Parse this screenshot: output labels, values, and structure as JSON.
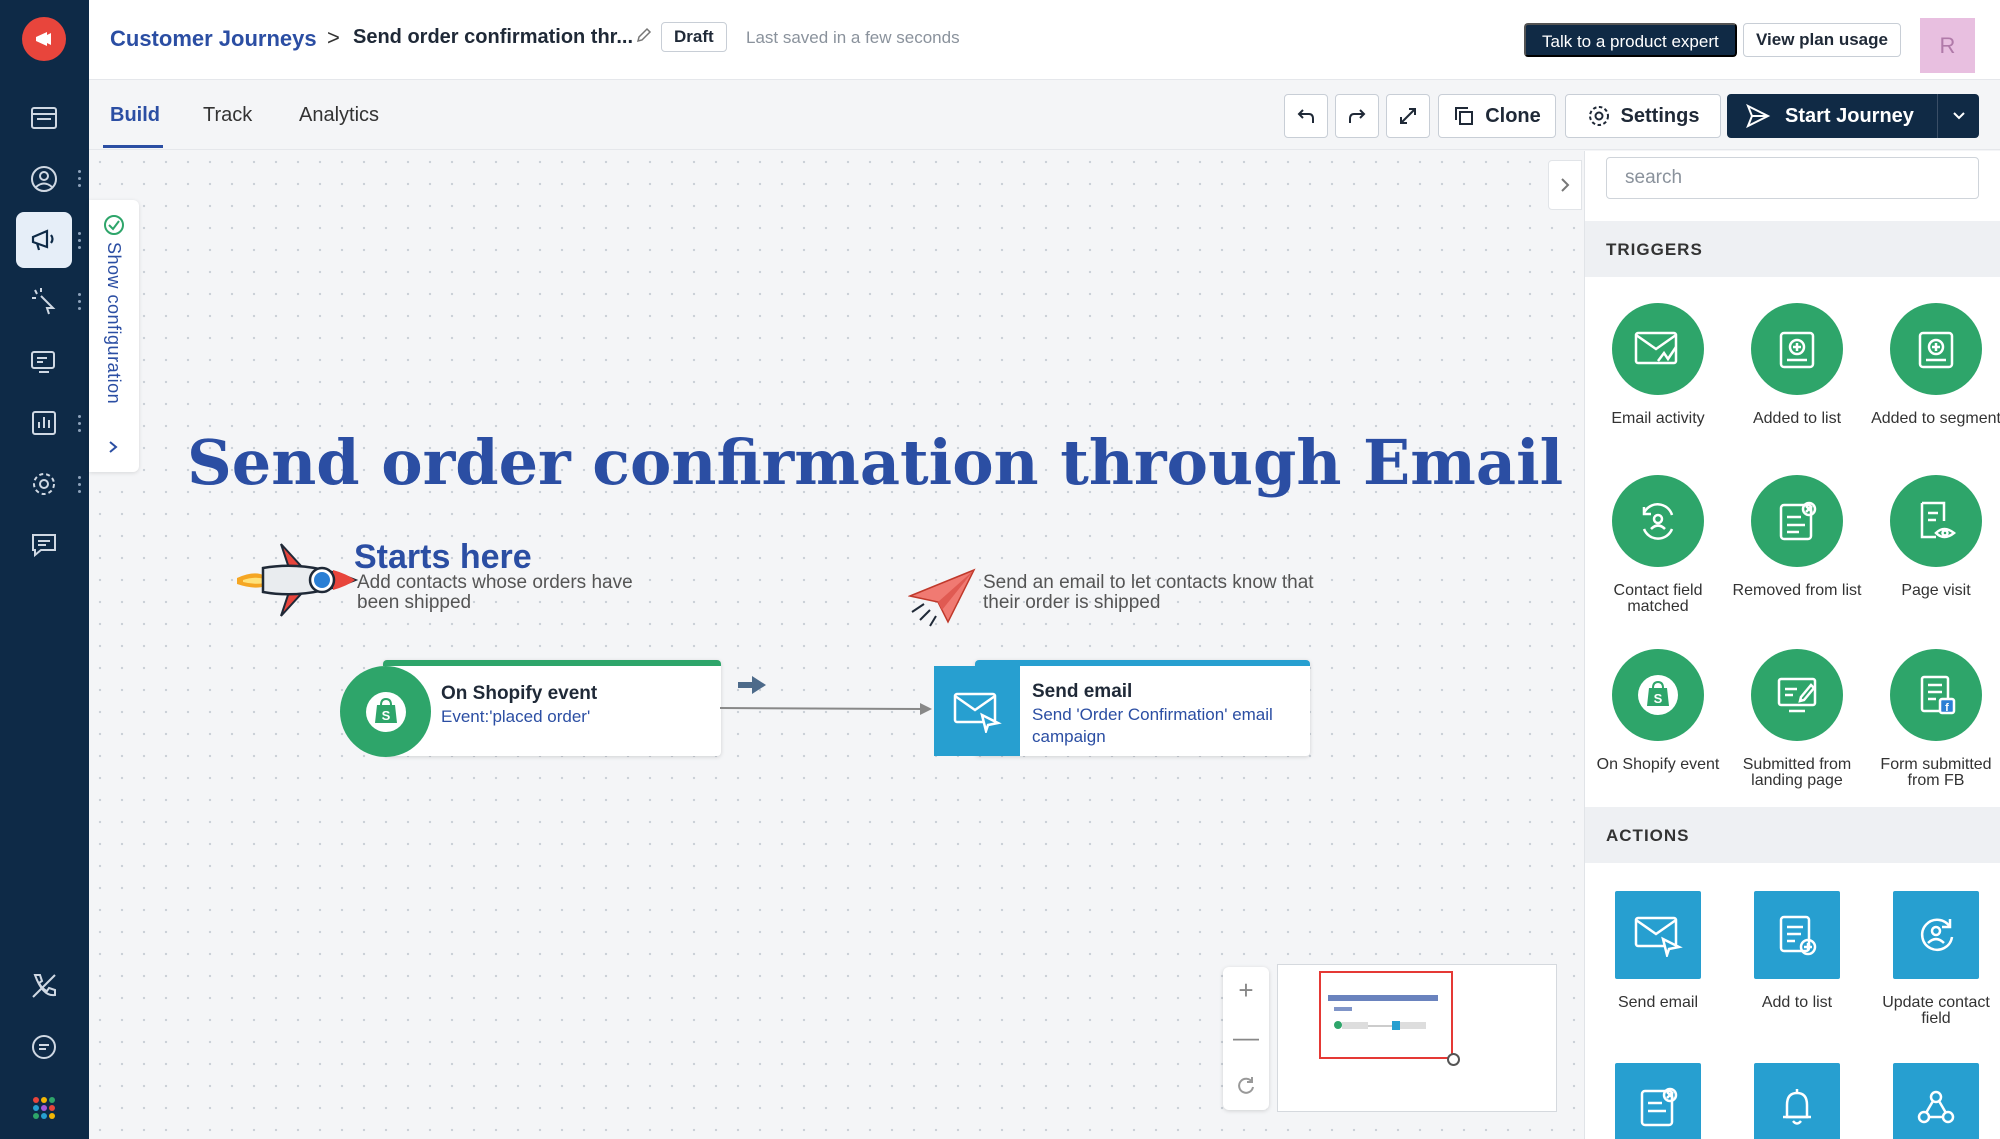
{
  "header": {
    "breadcrumb_root": "Customer Journeys",
    "breadcrumb_sep": ">",
    "title": "Send order confirmation thr...",
    "status": "Draft",
    "saved": "Last saved in a few seconds",
    "expert_button": "Talk to a product expert",
    "usage_button": "View plan usage",
    "avatar": "R"
  },
  "tabs": [
    {
      "label": "Build",
      "active": true
    },
    {
      "label": "Track",
      "active": false
    },
    {
      "label": "Analytics",
      "active": false
    }
  ],
  "toolbar": {
    "clone": "Clone",
    "settings": "Settings",
    "start": "Start Journey"
  },
  "canvas": {
    "show_config": "Show configuration",
    "heading": "Send order confirmation through Email",
    "starts_here": "Starts here",
    "starts_desc": "Add contacts whose orders have been shipped",
    "send_desc": "Send an email to let contacts know that their order is shipped",
    "node_trigger": {
      "title": "On Shopify event",
      "sub": "Event:'placed order'"
    },
    "node_action": {
      "title": "Send email",
      "sub": "Send 'Order Confirmation' email campaign"
    },
    "zoom_in": "+",
    "zoom_out": "—"
  },
  "panel": {
    "search_placeholder": "search",
    "triggers_title": "TRIGGERS",
    "actions_title": "ACTIONS",
    "triggers": [
      {
        "label": "Email activity",
        "icon": "email-activity-icon"
      },
      {
        "label": "Added to list",
        "icon": "list-add-icon"
      },
      {
        "label": "Added to segment",
        "icon": "segment-add-icon"
      },
      {
        "label": "Contact field matched",
        "icon": "contact-refresh-icon"
      },
      {
        "label": "Removed from list",
        "icon": "list-remove-icon"
      },
      {
        "label": "Page visit",
        "icon": "page-eye-icon"
      },
      {
        "label": "On Shopify event",
        "icon": "shopify-icon"
      },
      {
        "label": "Submitted from landing page",
        "icon": "landing-page-icon"
      },
      {
        "label": "Form submitted from FB",
        "icon": "facebook-form-icon"
      }
    ],
    "actions": [
      {
        "label": "Send email",
        "icon": "send-email-icon"
      },
      {
        "label": "Add to list",
        "icon": "list-add-icon"
      },
      {
        "label": "Update contact field",
        "icon": "contact-update-icon"
      }
    ]
  },
  "colors": {
    "navy": "#0e2a47",
    "brand_blue": "#2b4ea3",
    "trigger_green": "#2ea56a",
    "action_blue": "#279fd0",
    "logo_red": "#e8453c"
  }
}
